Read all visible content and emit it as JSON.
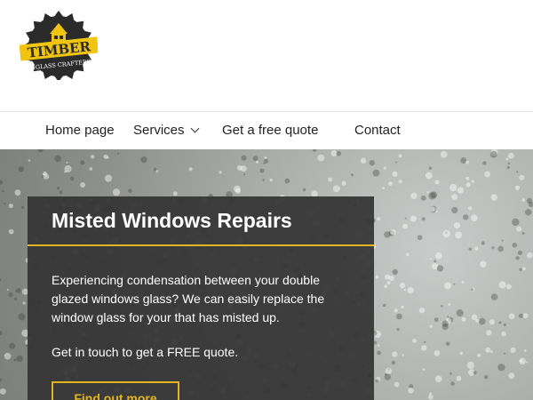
{
  "logo": {
    "brand": "TIMBER",
    "tagline": "&GLASS CRAFTERS",
    "brand_color": "#f1c40f",
    "dark_color": "#2b2b2b"
  },
  "nav": {
    "items": [
      {
        "label": "Home page"
      },
      {
        "label": "Services"
      },
      {
        "label": "Get a free quote"
      },
      {
        "label": "Contact"
      }
    ]
  },
  "hero": {
    "title": "Misted Windows Repairs",
    "body": "Experiencing condensation between your double glazed windows glass? We can easily replace the window glass for your that has misted up.",
    "cta_text": "Get in touch to get a FREE quote.",
    "button_label": "Find out more",
    "accent_color": "#e3b320"
  }
}
